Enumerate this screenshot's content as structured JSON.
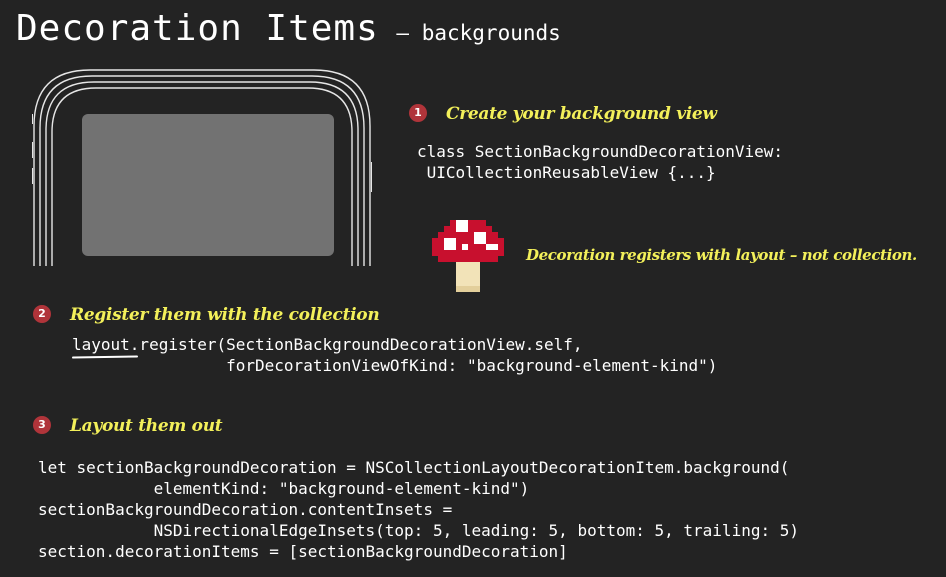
{
  "header": {
    "title": "Decoration Items",
    "subtitle": "– backgrounds"
  },
  "steps": [
    {
      "number": "1",
      "label": "Create your background view",
      "code": "class SectionBackgroundDecorationView:\n UICollectionReusableView {...}"
    },
    {
      "number": "2",
      "label": "Register them with the collection",
      "code_prefix": "layout",
      "code": ".register(SectionBackgroundDecorationView.self,\n                forDecorationViewOfKind: \"background-element-kind\")"
    },
    {
      "number": "3",
      "label": "Layout them out",
      "code": "let sectionBackgroundDecoration = NSCollectionLayoutDecorationItem.background(\n            elementKind: \"background-element-kind\")\nsectionBackgroundDecoration.contentInsets =\n            NSDirectionalEdgeInsets(top: 5, leading: 5, bottom: 5, trailing: 5)\nsection.decorationItems = [sectionBackgroundDecoration]"
    }
  ],
  "note": "Decoration registers with layout – not collection.",
  "icons": {
    "phone": "phone-outline-icon",
    "mushroom": "mushroom-icon"
  },
  "colors": {
    "background": "#232323",
    "accent_yellow": "#f3f05a",
    "badge_red": "#b0343a",
    "phone_screen": "#727272"
  }
}
